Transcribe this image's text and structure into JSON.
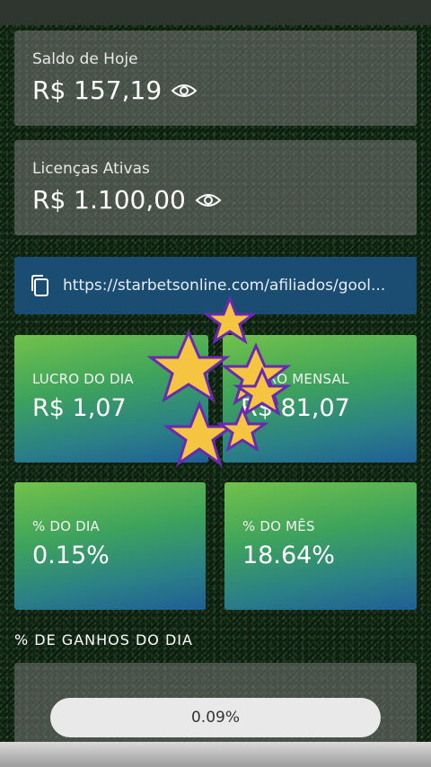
{
  "balance_today": {
    "label": "Saldo de Hoje",
    "value": "R$ 157,19"
  },
  "active_licenses": {
    "label": "Licenças Ativas",
    "value": "R$ 1.100,00"
  },
  "affiliate": {
    "url": "https://starbetsonline.com/afiliados/gool..."
  },
  "profit_day": {
    "label": "LUCRO DO DIA",
    "value": "R$ 1,07"
  },
  "profit_month": {
    "label": "LUCRO MENSAL",
    "value": "R$ 81,07"
  },
  "pct_day": {
    "label": "% DO DIA",
    "value": "0.15%"
  },
  "pct_month": {
    "label": "% DO MÊS",
    "value": "18.64%"
  },
  "daily_gains": {
    "title": "% DE GANHOS DO DIA",
    "progress_label": "0.09%",
    "progress_fraction": 0.0009
  },
  "colors": {
    "link_bar": "#1b4d73",
    "gradient_top": "#72c24a",
    "gradient_bottom": "#1f5f96",
    "star": "#f5c542"
  },
  "icons": {
    "eye": "eye-icon",
    "copy": "copy-icon",
    "stars": "star-icon"
  }
}
